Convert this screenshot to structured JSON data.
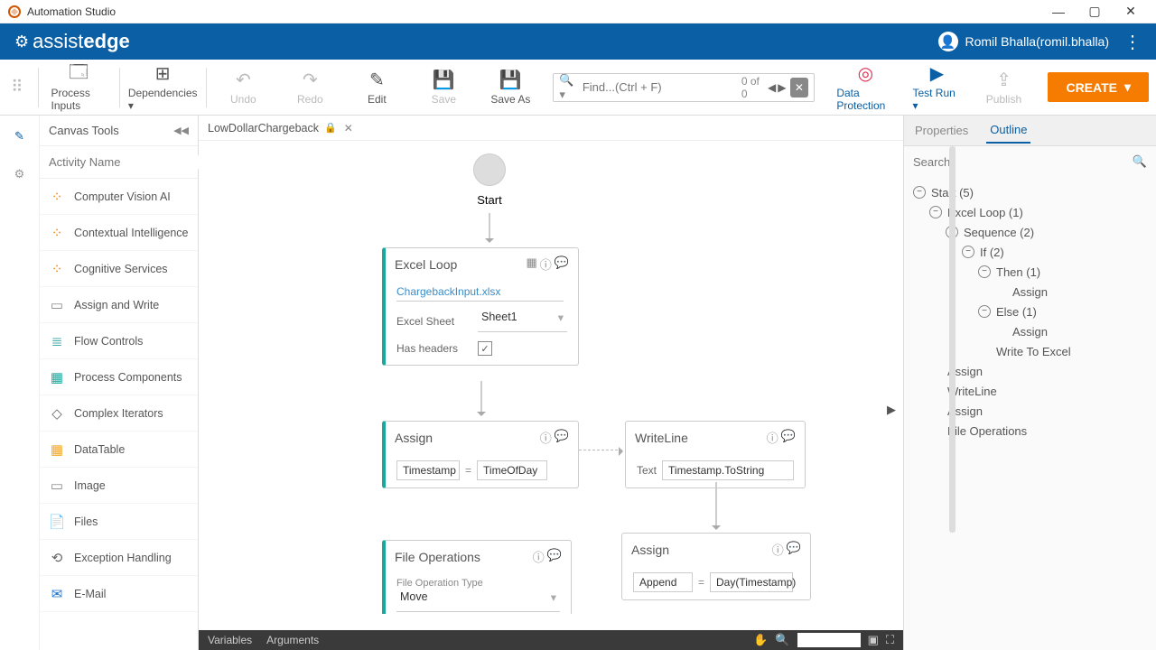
{
  "titlebar": {
    "title": "Automation Studio"
  },
  "appbar": {
    "brand_a": "assist",
    "brand_b": "edge",
    "user": "Romil Bhalla(romil.bhalla)"
  },
  "toolbar": {
    "process_inputs": "Process Inputs",
    "dependencies": "Dependencies",
    "undo": "Undo",
    "redo": "Redo",
    "edit": "Edit",
    "save": "Save",
    "save_as": "Save As",
    "search_placeholder": "Find...(Ctrl + F)",
    "search_count": "0 of 0",
    "data_protection": "Data Protection",
    "test_run": "Test Run",
    "publish": "Publish",
    "create": "CREATE"
  },
  "canvas_tools": {
    "header": "Canvas Tools",
    "search_placeholder": "Activity Name",
    "items": [
      {
        "icon": "⁘",
        "label": "Computer Vision AI",
        "color": "#f57c00"
      },
      {
        "icon": "⁘",
        "label": "Contextual Intelligence",
        "color": "#f57c00"
      },
      {
        "icon": "⁘",
        "label": "Cognitive Services",
        "color": "#f57c00"
      },
      {
        "icon": "▭",
        "label": "Assign and Write",
        "color": "#888"
      },
      {
        "icon": "≣",
        "label": "Flow Controls",
        "color": "#4aa"
      },
      {
        "icon": "▦",
        "label": "Process Components",
        "color": "#1aa89c"
      },
      {
        "icon": "◇",
        "label": "Complex Iterators",
        "color": "#666"
      },
      {
        "icon": "▦",
        "label": "DataTable",
        "color": "#f5a623"
      },
      {
        "icon": "▭",
        "label": "Image",
        "color": "#888"
      },
      {
        "icon": "📄",
        "label": "Files",
        "color": "#2ea44f"
      },
      {
        "icon": "⟲",
        "label": "Exception Handling",
        "color": "#666"
      },
      {
        "icon": "✉",
        "label": "E-Mail",
        "color": "#1976d2"
      }
    ]
  },
  "tab": {
    "name": "LowDollarChargeback"
  },
  "nodes": {
    "start": "Start",
    "excel_loop": {
      "title": "Excel Loop",
      "file": "ChargebackInput.xlsx",
      "sheet_label": "Excel Sheet",
      "sheet": "Sheet1",
      "headers_label": "Has headers"
    },
    "assign1": {
      "title": "Assign",
      "left": "Timestamp",
      "right": "TimeOfDay"
    },
    "writeline": {
      "title": "WriteLine",
      "label": "Text",
      "value": "Timestamp.ToString"
    },
    "assign2": {
      "title": "Assign",
      "left": "Append",
      "right": "Day(Timestamp)"
    },
    "fileops": {
      "title": "File Operations",
      "type_label": "File Operation Type",
      "type": "Move"
    }
  },
  "rightpanel": {
    "tab_props": "Properties",
    "tab_outline": "Outline",
    "search_placeholder": "Search",
    "tree": [
      {
        "depth": 0,
        "toggle": true,
        "label": "Start (5)"
      },
      {
        "depth": 1,
        "toggle": true,
        "label": "Excel Loop (1)"
      },
      {
        "depth": 2,
        "toggle": true,
        "label": "Sequence (2)"
      },
      {
        "depth": 3,
        "toggle": true,
        "label": "If (2)"
      },
      {
        "depth": 4,
        "toggle": true,
        "label": "Then (1)"
      },
      {
        "depth": 5,
        "toggle": false,
        "label": "Assign"
      },
      {
        "depth": 4,
        "toggle": true,
        "label": "Else (1)"
      },
      {
        "depth": 5,
        "toggle": false,
        "label": "Assign"
      },
      {
        "depth": 4,
        "toggle": false,
        "label": "Write To Excel"
      },
      {
        "depth": 1,
        "toggle": false,
        "label": "Assign"
      },
      {
        "depth": 1,
        "toggle": false,
        "label": "WriteLine"
      },
      {
        "depth": 1,
        "toggle": false,
        "label": "Assign"
      },
      {
        "depth": 1,
        "toggle": false,
        "label": "File Operations"
      }
    ]
  },
  "bottombar": {
    "variables": "Variables",
    "arguments": "Arguments"
  }
}
